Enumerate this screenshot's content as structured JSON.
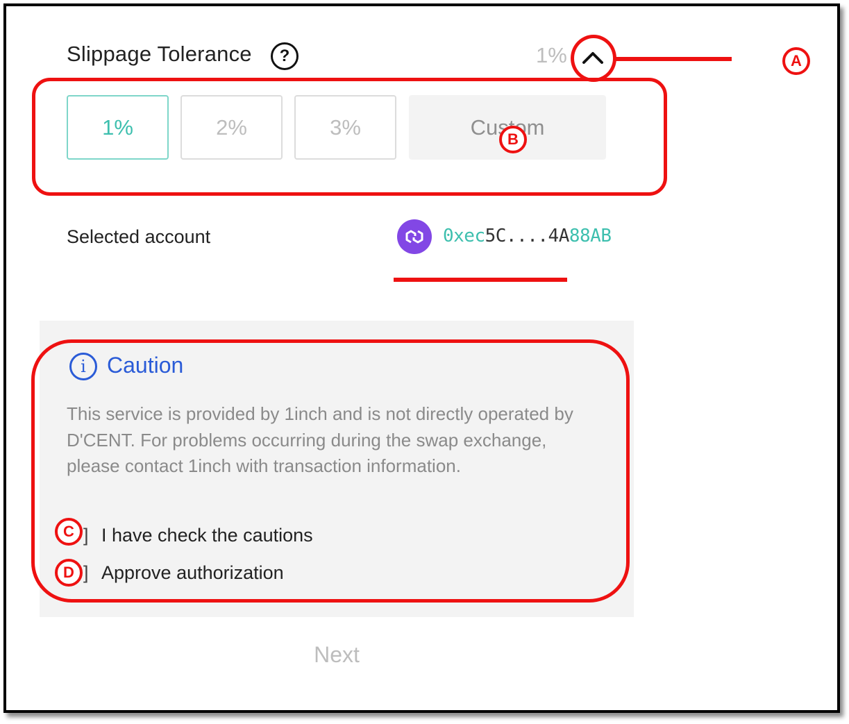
{
  "slippage": {
    "title": "Slippage Tolerance",
    "help_symbol": "?",
    "current_value": "1%",
    "options": [
      "1%",
      "2%",
      "3%"
    ],
    "custom_label": "Custom",
    "selected_index": 0
  },
  "account": {
    "label": "Selected account",
    "network_icon": "polygon-icon",
    "address_prefix": "0xec",
    "address_middle": "5C....4A",
    "address_suffix": "88AB"
  },
  "caution": {
    "title": "Caution",
    "info_symbol": "i",
    "body": "This service is provided by 1inch and is not directly operated by D'CENT. For problems occurring during the swap exchange, please contact 1inch with transaction information.",
    "checks": [
      {
        "label": "I have check the cautions",
        "checked": false
      },
      {
        "label": "Approve authorization",
        "checked": false
      }
    ]
  },
  "next_label": "Next",
  "annotations": {
    "a": "A",
    "b": "B",
    "c": "C",
    "d": "D"
  },
  "colors": {
    "accent_teal": "#3dbfae",
    "caution_blue": "#2a5bd7",
    "annotation_red": "#ee1111",
    "polygon_purple": "#8247e5"
  }
}
